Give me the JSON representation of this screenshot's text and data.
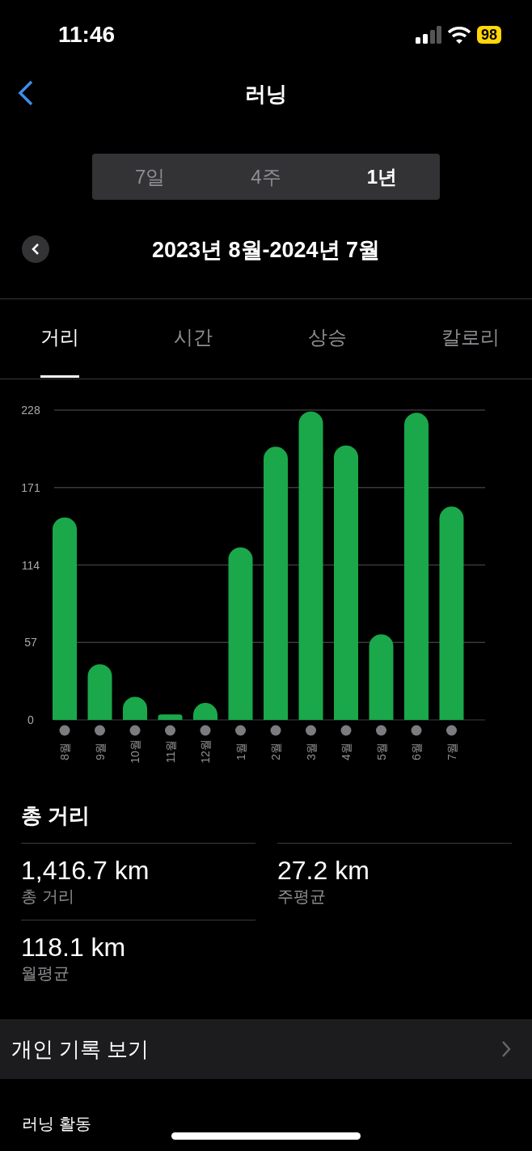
{
  "status_bar": {
    "time": "11:46",
    "battery": "98"
  },
  "nav": {
    "title": "러닝"
  },
  "periods": [
    {
      "label": "7일",
      "selected": false
    },
    {
      "label": "4주",
      "selected": false
    },
    {
      "label": "1년",
      "selected": true
    }
  ],
  "date_range": "2023년 8월-2024년 7월",
  "tabs": [
    {
      "label": "거리",
      "selected": true
    },
    {
      "label": "시간",
      "selected": false
    },
    {
      "label": "상승",
      "selected": false
    },
    {
      "label": "칼로리",
      "selected": false
    }
  ],
  "chart": {
    "chart_data": {
      "type": "bar",
      "categories": [
        "8월",
        "9월",
        "10월",
        "11월",
        "12월",
        "1월",
        "2월",
        "3월",
        "4월",
        "5월",
        "6월",
        "7월"
      ],
      "series": [
        {
          "color": "#1aa84a",
          "values": [
            149,
            41,
            17,
            4,
            12.5,
            127,
            201,
            227,
            202,
            63,
            226,
            157
          ]
        }
      ],
      "grid": true,
      "ylim": [
        0,
        228
      ],
      "yticks": [
        0,
        57,
        114,
        171,
        228
      ]
    }
  },
  "summary": {
    "title": "총 거리",
    "stats": [
      {
        "value": "1,416.7 km",
        "label": "총 거리"
      },
      {
        "value": "27.2 km",
        "label": "주평균"
      },
      {
        "value": "118.1 km",
        "label": "월평균"
      }
    ]
  },
  "records_link": "개인 기록 보기",
  "section_title": "러닝 활동"
}
